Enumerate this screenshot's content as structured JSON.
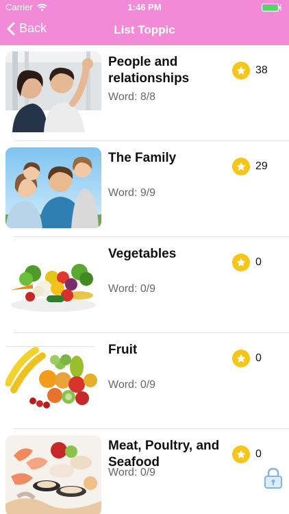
{
  "status": {
    "carrier": "Carrier",
    "time": "1:46 PM"
  },
  "nav": {
    "back_label": "Back",
    "title": "List Toppic"
  },
  "topics": [
    {
      "title": "People and relationships",
      "words": "Word: 8/8",
      "stars": "38"
    },
    {
      "title": "The Family",
      "words": "Word: 9/9",
      "stars": "29"
    },
    {
      "title": "Vegetables",
      "words": "Word: 0/9",
      "stars": "0"
    },
    {
      "title": "Fruit",
      "words": "Word: 0/9",
      "stars": "0"
    },
    {
      "title": "Meat, Poultry, and Seafood",
      "words": "Word: 0/9",
      "stars": "0"
    }
  ],
  "colors": {
    "nav": "#f28ad8",
    "star": "#f5c518",
    "lock": "#7fb6e6"
  }
}
